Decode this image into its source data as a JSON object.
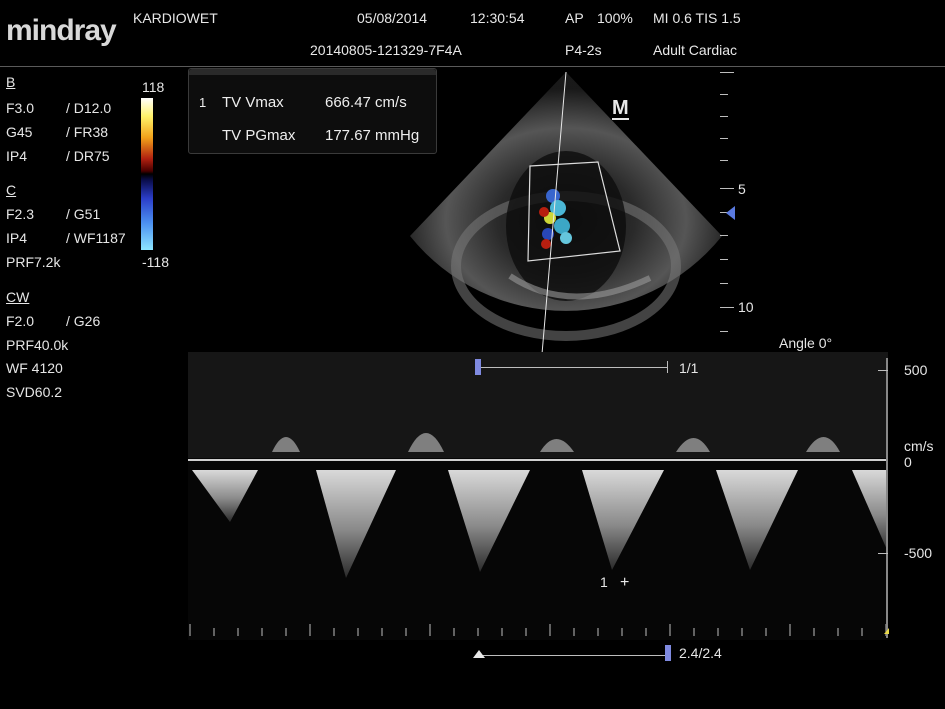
{
  "header": {
    "brand": "mindray",
    "patient": "KARDIOWET",
    "date": "05/08/2014",
    "time": "12:30:54",
    "exam_id": "20140805-121329-7F4A",
    "ap": "AP",
    "ap_value": "100%",
    "probe": "P4-2s",
    "mi_tis": "MI 0.6 TIS 1.5",
    "preset": "Adult Cardiac"
  },
  "params": {
    "b": {
      "title": "B",
      "rows": [
        [
          "F3.0",
          "/ D12.0"
        ],
        [
          "G45",
          "/ FR38"
        ],
        [
          "IP4",
          "/ DR75"
        ]
      ]
    },
    "c": {
      "title": "C",
      "rows": [
        [
          "F2.3",
          "/ G51"
        ],
        [
          "IP4",
          "/ WF1187"
        ]
      ],
      "prf": "PRF7.2k"
    },
    "cw": {
      "title": "CW",
      "rows": [
        [
          "F2.0",
          "/ G26"
        ]
      ],
      "extra": [
        "PRF40.0k",
        "WF 4120",
        "SVD60.2"
      ]
    }
  },
  "colorbar": {
    "max": "118",
    "min": "-118"
  },
  "measurements": {
    "index": "1",
    "rows": [
      {
        "label": "TV Vmax",
        "value": "666.47 cm/s"
      },
      {
        "label": "TV PGmax",
        "value": "177.67 mmHg"
      }
    ]
  },
  "depth_scale": {
    "labels": [
      "5",
      "10"
    ]
  },
  "marker": "M",
  "angle": "Angle 0°",
  "doppler": {
    "top_fraction": "1/1",
    "scale_labels": [
      "500",
      "cm/s",
      "0",
      "-500"
    ],
    "bottom_fraction": "2.4/2.4",
    "cursor_label": "1"
  }
}
